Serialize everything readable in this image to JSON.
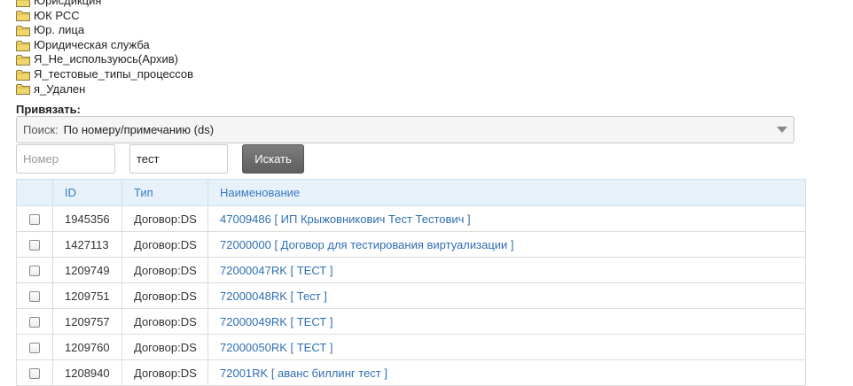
{
  "folders": [
    "Юрисдикция",
    "ЮК РСС",
    "Юр. лица",
    "Юридическая служба",
    "Я_Не_используюсь(Архив)",
    "Я_тестовые_типы_процессов",
    "я_Удален"
  ],
  "bind": {
    "label": "Привязать:"
  },
  "search_select": {
    "prefix": "Поиск:",
    "value": "По номеру/примечанию (ds)"
  },
  "number_input": {
    "placeholder": "Номер",
    "value": ""
  },
  "name_input": {
    "value": "тест"
  },
  "search_button": {
    "label": "Искать"
  },
  "table": {
    "headers": {
      "id": "ID",
      "type": "Тип",
      "name": "Наименование"
    },
    "rows": [
      {
        "id": "1945356",
        "type": "Договор:DS",
        "name": "47009486 [ ИП Крыжовникович Тест Тестович ]"
      },
      {
        "id": "1427113",
        "type": "Договор:DS",
        "name": "72000000 [ Договор для тестирования виртуализации ]"
      },
      {
        "id": "1209749",
        "type": "Договор:DS",
        "name": "72000047RK [ ТЕСТ ]"
      },
      {
        "id": "1209751",
        "type": "Договор:DS",
        "name": "72000048RK [ Тест ]"
      },
      {
        "id": "1209757",
        "type": "Договор:DS",
        "name": "72000049RK [ ТЕСТ ]"
      },
      {
        "id": "1209760",
        "type": "Договор:DS",
        "name": "72000050RK [ ТЕСТ ]"
      },
      {
        "id": "1208940",
        "type": "Договор:DS",
        "name": "72001RK [ аванс биллинг тест ]"
      }
    ]
  },
  "colors": {
    "header_bg": "#e6f1fa",
    "header_text": "#3a7bc0",
    "link": "#2f6fb3",
    "folder": "#f1d66b"
  },
  "icons": {
    "folder": "folder-icon",
    "dropdown": "chevron-down-icon"
  }
}
